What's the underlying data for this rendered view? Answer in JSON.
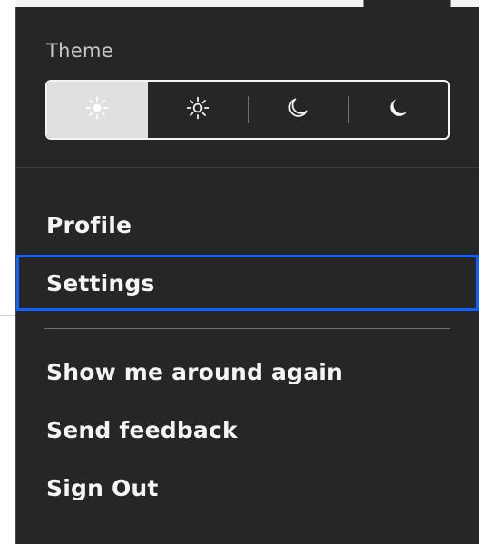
{
  "menu": {
    "theme_label": "Theme",
    "theme_options": [
      {
        "icon": "sun-light-icon",
        "selected": true
      },
      {
        "icon": "sun-outline-icon",
        "selected": false
      },
      {
        "icon": "moon-outline-icon",
        "selected": false
      },
      {
        "icon": "moon-filled-icon",
        "selected": false
      }
    ],
    "items": {
      "profile": "Profile",
      "settings": "Settings",
      "show_around": "Show me around again",
      "send_feedback": "Send feedback",
      "sign_out": "Sign Out"
    }
  },
  "colors": {
    "menu_bg": "#262626",
    "text": "#f4f4f4",
    "focus": "#0f62fe",
    "selected_option": "#e0e0e0"
  }
}
